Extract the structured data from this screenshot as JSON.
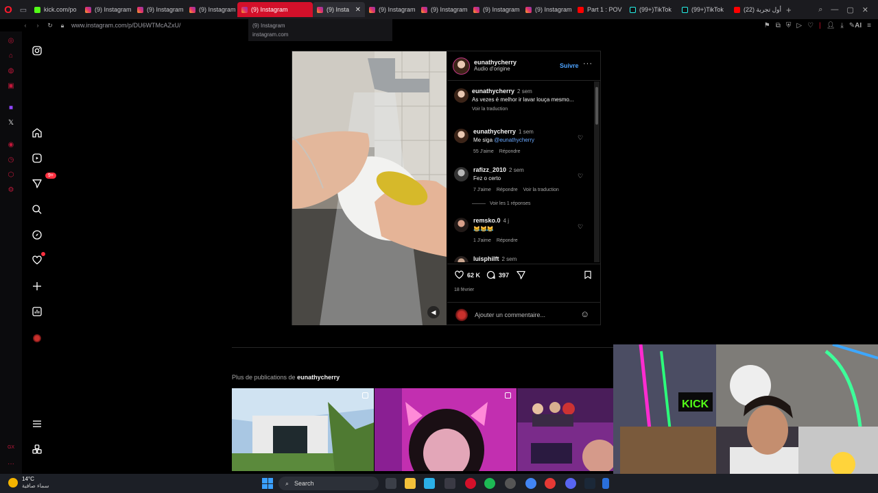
{
  "browser": {
    "tabs": [
      {
        "title": "kick.com/po",
        "icon": "kick",
        "state": "normal"
      },
      {
        "title": "(9) Instagram",
        "icon": "instagram",
        "state": "normal"
      },
      {
        "title": "(9) Instagram",
        "icon": "instagram",
        "state": "normal"
      },
      {
        "title": "(9) Instagram",
        "icon": "instagram",
        "state": "normal"
      },
      {
        "title": "(9) Instagram",
        "icon": "instagram",
        "state": "hovered"
      },
      {
        "title": "(9) Insta",
        "icon": "instagram",
        "state": "current"
      },
      {
        "title": "(9) Instagram",
        "icon": "instagram",
        "state": "normal"
      },
      {
        "title": "(9) Instagram",
        "icon": "instagram",
        "state": "normal"
      },
      {
        "title": "(9) Instagram",
        "icon": "instagram",
        "state": "normal"
      },
      {
        "title": "(9) Instagram",
        "icon": "instagram",
        "state": "normal"
      },
      {
        "title": "Part 1 : POV",
        "icon": "youtube",
        "state": "normal"
      },
      {
        "title": "(99+)TikTok",
        "icon": "tiktok",
        "state": "normal"
      },
      {
        "title": "(99+)TikTok",
        "icon": "tiktok",
        "state": "normal"
      },
      {
        "title": "(22) أول تجربة",
        "icon": "youtube",
        "state": "normal"
      }
    ],
    "tooltip": {
      "title": "(9) Instagram",
      "domain": "instagram.com"
    },
    "url": "www.instagram.com/p/DU6WTMcAZxU/",
    "ai_label": "AI",
    "accent_color": "#d3102a"
  },
  "post": {
    "author": "eunathycherry",
    "audio": "Audio d'origine",
    "follow_label": "Suivre",
    "caption": {
      "user": "eunathycherry",
      "time": "2 sem",
      "text": "As vezes é melhor ir lavar louça mesmo...",
      "translate": "Voir la traduction"
    },
    "comments": [
      {
        "user": "eunathycherry",
        "time": "1 sem",
        "text_prefix": "Me siga ",
        "mention": "@eunathycherry",
        "likes": "55 J'aime",
        "reply": "Répondre",
        "translate": ""
      },
      {
        "user": "rafizz_2010",
        "time": "2 sem",
        "text_prefix": "Fez o certo",
        "mention": "",
        "likes": "7 J'aime",
        "reply": "Répondre",
        "translate": "Voir la traduction",
        "replies": "Voir les 1 réponses"
      },
      {
        "user": "remsko.0",
        "time": "4 j",
        "text_prefix": "😹😹😹",
        "mention": "",
        "likes": "1 J'aime",
        "reply": "Répondre",
        "translate": ""
      },
      {
        "user": "luisphilft",
        "time": "2 sem",
        "text_prefix": "",
        "mention": "",
        "likes": "",
        "reply": "",
        "translate": ""
      }
    ],
    "likes_count": "62 K",
    "comments_count": "397",
    "date": "18 février",
    "add_comment_placeholder": "Ajouter un commentaire..."
  },
  "more_posts": {
    "label": "Plus de publications de ",
    "user": "eunathycherry"
  },
  "taskbar": {
    "temperature": "14°C",
    "weather_text": "سماء صافية",
    "search_label": "Search"
  }
}
